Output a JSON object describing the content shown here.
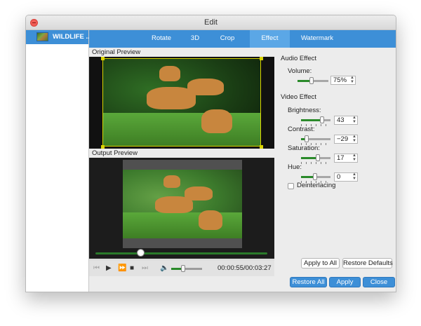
{
  "window": {
    "title": "Edit"
  },
  "sidebar": {
    "items": [
      {
        "label": "WILDLIFE ..."
      }
    ]
  },
  "tabs": [
    {
      "label": "Rotate"
    },
    {
      "label": "3D"
    },
    {
      "label": "Crop"
    },
    {
      "label": "Effect",
      "active": true
    },
    {
      "label": "Watermark"
    }
  ],
  "preview": {
    "original_label": "Original Preview",
    "output_label": "Output Preview"
  },
  "player": {
    "timecode": "00:00:55/00:03:27",
    "progress": 0.26,
    "volume": 0.35
  },
  "audio": {
    "section_title": "Audio Effect",
    "volume_label": "Volume:",
    "volume_value": "75%",
    "volume_level": 0.75
  },
  "video": {
    "section_title": "Video Effect",
    "brightness": {
      "label": "Brightness:",
      "value": "43"
    },
    "contrast": {
      "label": "Contrast:",
      "value": "−29"
    },
    "saturation": {
      "label": "Saturation:",
      "value": "17"
    },
    "hue": {
      "label": "Hue:",
      "value": "0"
    },
    "deinterlacing_label": "Deinterlacing",
    "deinterlacing_checked": false
  },
  "buttons": {
    "apply_to_all": "Apply to All",
    "restore_defaults": "Restore Defaults",
    "restore_all": "Restore All",
    "apply": "Apply",
    "close": "Close"
  },
  "colors": {
    "accent": "#3d8fd7",
    "active_tab": "#5ba7e6",
    "slider_fill": "#2a8a2a",
    "crop_frame": "#d9d300"
  }
}
